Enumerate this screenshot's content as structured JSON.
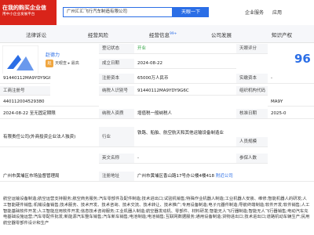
{
  "header": {
    "brand_line1": "在我的购买企业信",
    "brand_line2": "用中小企业发展平台",
    "search_value": "广州汇汇飞行汽车制造有限公司",
    "search_button": "天眼一下",
    "nav": [
      "企业服务",
      "应用"
    ],
    "accent": "#2b6ee6",
    "brand_color": "#d9241a"
  },
  "tabs": [
    {
      "label": "法律诉讼",
      "badge": ""
    },
    {
      "label": "经营风险",
      "badge": ""
    },
    {
      "label": "经营信息",
      "badge": "99+"
    },
    {
      "label": "公司发展",
      "badge": ""
    },
    {
      "label": "知识产权",
      "badge": ""
    }
  ],
  "company": {
    "rep_name": "赵德力",
    "rep_avatar": "赵",
    "rep_tag": "天眼查 ▸ 最高",
    "status_label": "登记状态",
    "status_value": "开业",
    "score_label": "天眼评分",
    "score_value": "96",
    "est_date_label": "成立日期",
    "est_date_value": "2024-08-22",
    "credit_label": "统一社会信用代码",
    "credit_value": "91440112MA9YDY9G6C",
    "capital_label": "注册资本",
    "capital_value": "65000万人民币",
    "paid_label": "实缴资本",
    "paid_value": "-",
    "reg_no_label": "工商注册号",
    "reg_no_value": "440112004529380",
    "taxpayer_no_label": "纳税人识别号",
    "taxpayer_no_value": "91440112MA9YDY9G6C",
    "org_code_label": "组织机构代码",
    "org_code_value": "MA9Y",
    "term_value": "2024-08-22 至无固定期限",
    "taxpayer_qual_label": "纳税人资质",
    "taxpayer_qual_value": "增值税一般纳税人",
    "approval_label": "核准日期",
    "approval_value": "2025-0",
    "company_type_value": "有限责任公司(外商投资企业法人独资)",
    "industry_label": "行业",
    "industry_value": "铁路、船舶、航空航天和其他运输设备制造业",
    "staff_label": "人员规模",
    "staff_value": "",
    "english_label": "英文名称",
    "english_value": "-",
    "insured_label": "参保人数",
    "authority_value": "广州市黄埔区市场监督管理局",
    "address_label": "注册地址",
    "address_value": "广州市黄埔区香山路17号办公楼4楼418",
    "address_link": "附近公司",
    "scope_text": "航空运输设备制造;航空运营支持服务;航空商务服务;汽车零部件及配件制造;技术进出口;试验机销售;特殊作业机器人制造;工业机器人安装、维修;智能机器人的研发;人工智能硬件销售;机械设备销售;技术服务、技术开发、技术咨询、技术交流、技术转让、技术推广;专用设备制造;电子元器件制造;导航终端制造;软件开发;软件销售;人工智能基础软件开发;人工智能应用软件开发;信息技术咨询服务;工业机器人制造;航空器发动机、零部件、材料研发;智能无人飞行器制造;智能无人飞行器销售;电动汽车充电基础设施运营;汽车零配件批发;新能源汽车整车销售;汽车新车销售;电池制造;电池销售;互联网数据服务;通用设备制造;货物进出口;技术进出口;道路机动车辆生产;民用航空器零部件设计和生产"
  }
}
